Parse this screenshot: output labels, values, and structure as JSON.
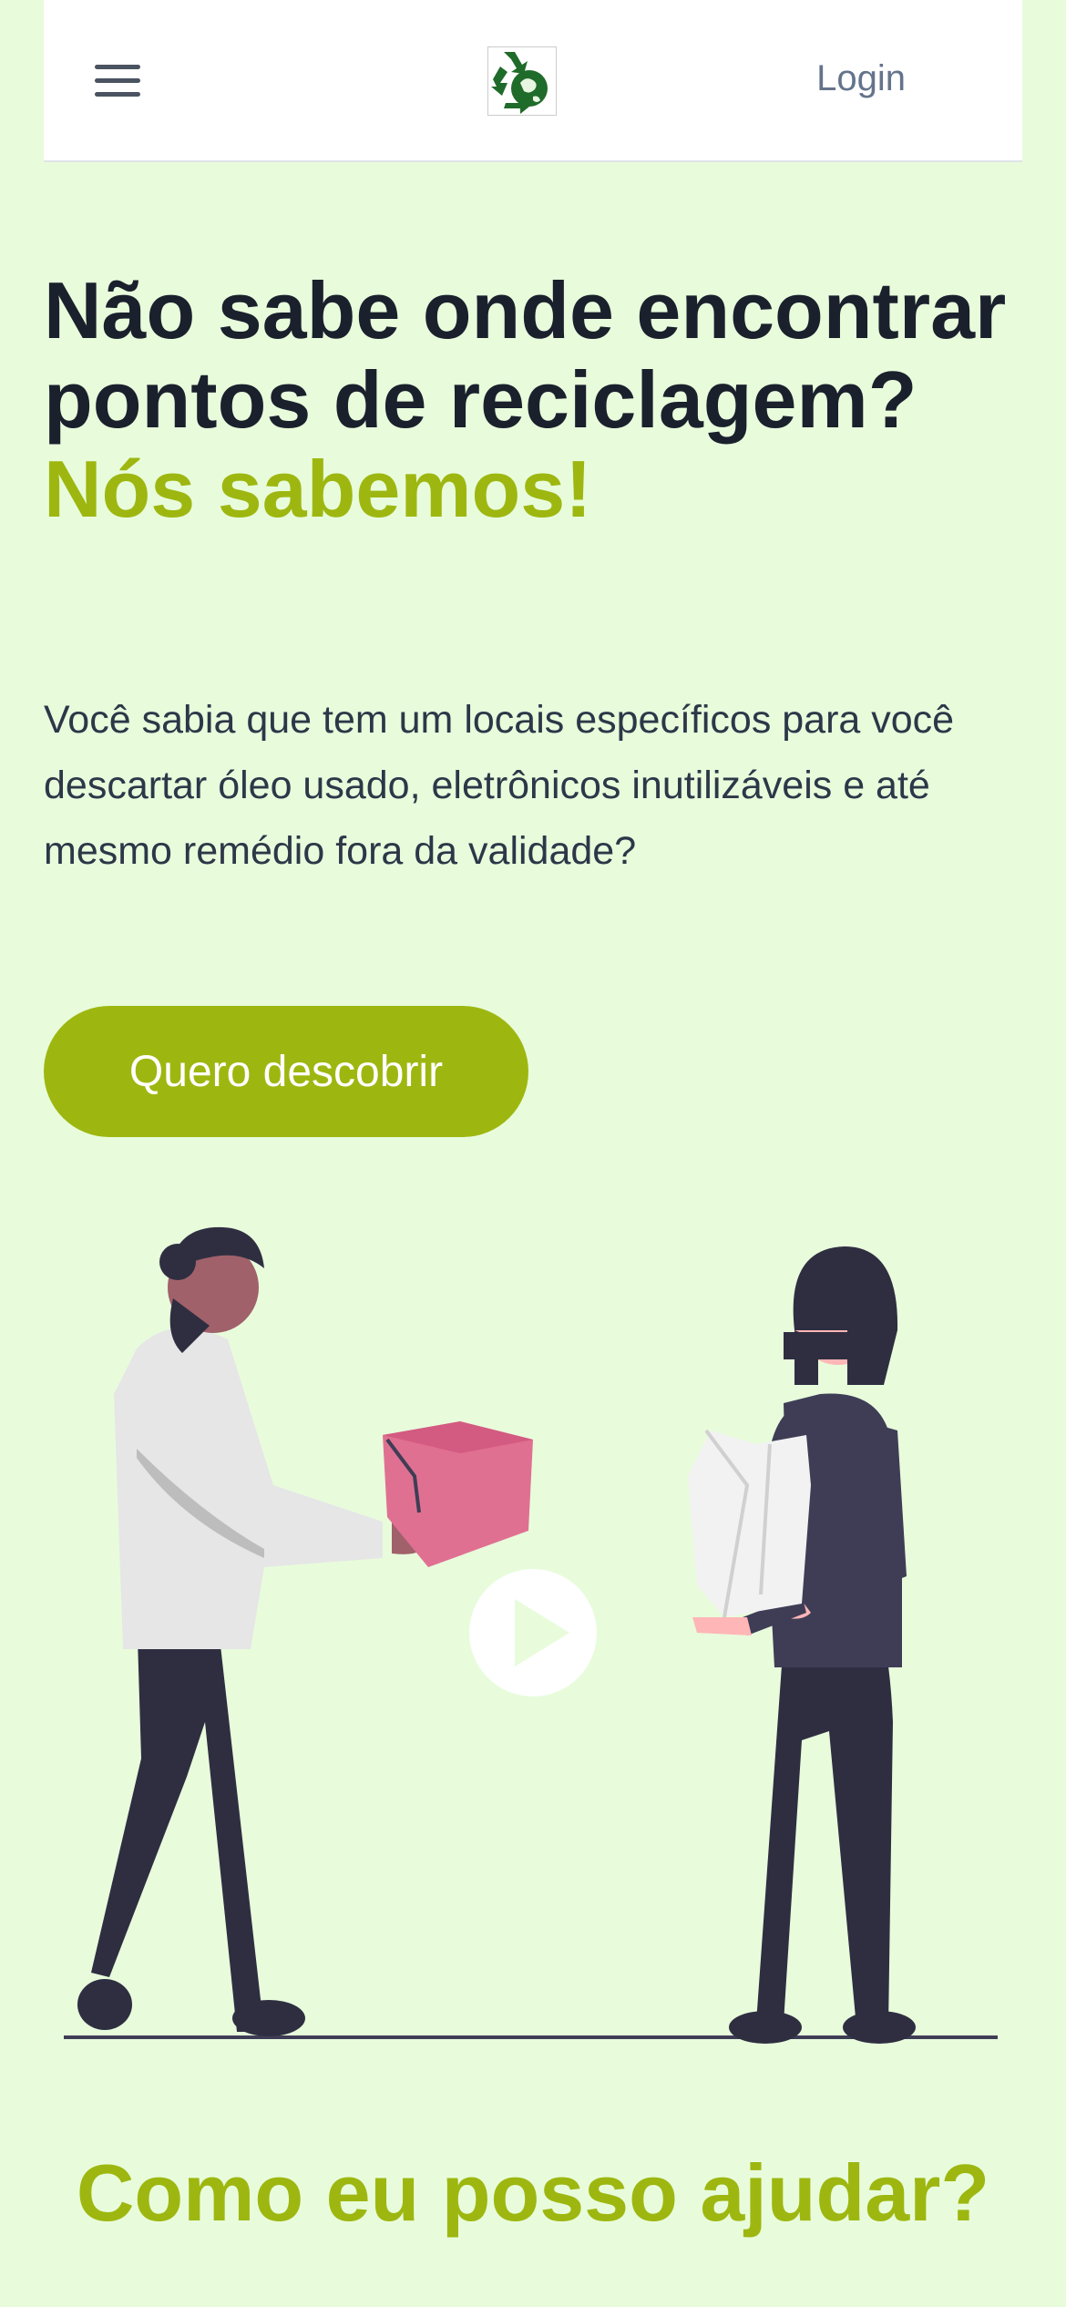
{
  "header": {
    "menu_icon": "hamburger-menu-icon",
    "logo_icon": "recycling-globe-logo",
    "login_label": "Login"
  },
  "hero": {
    "title_line": "Não sabe onde encontrar pontos de reciclagem?",
    "title_accent": "Nós sabemos!",
    "description": "Você sabia que tem um locais específicos para você descartar óleo usado, eletrônicos inutilizáveis e até mesmo remédio fora da validade?",
    "cta_label": "Quero descobrir"
  },
  "illustration": {
    "play_icon": "play-icon"
  },
  "section": {
    "title": "Como eu posso ajudar?"
  },
  "colors": {
    "background": "#e8fcdc",
    "accent": "#9eb710",
    "heading": "#1a202c",
    "text": "#2d3748"
  }
}
